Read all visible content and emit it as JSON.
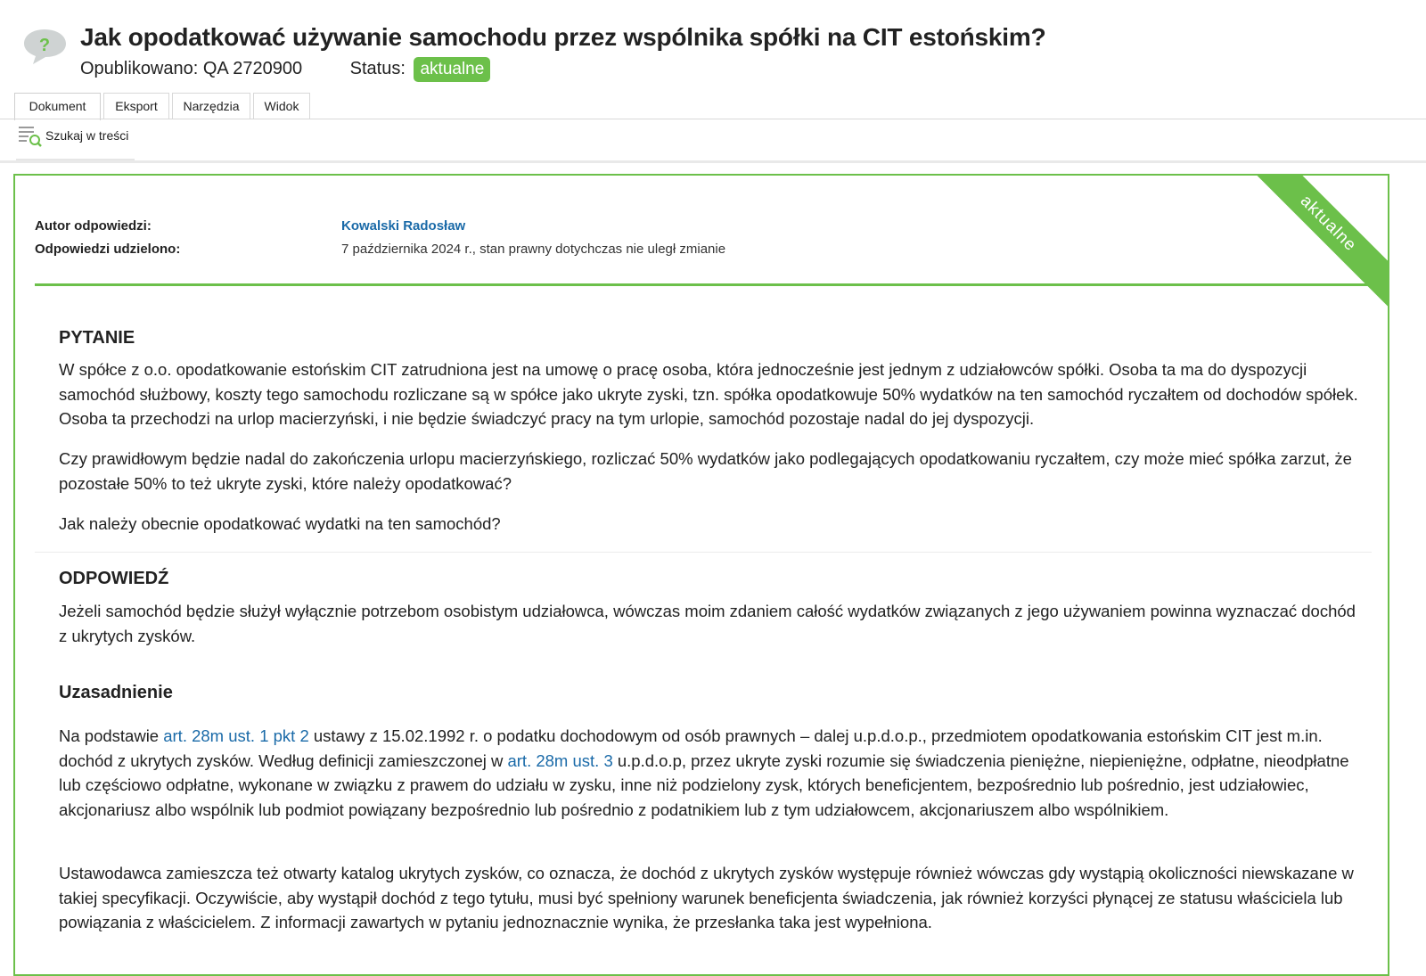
{
  "header": {
    "title": "Jak opodatkować używanie samochodu przez wspólnika spółki na CIT estońskim?",
    "published_label": "Opublikowano:",
    "published_value": "QA 2720900",
    "status_label": "Status:",
    "status_badge": "aktualne",
    "icon": "question-bubble-icon"
  },
  "tabs": [
    {
      "label": "Dokument",
      "active": true
    },
    {
      "label": "Eksport",
      "active": false
    },
    {
      "label": "Narzędzia",
      "active": false
    },
    {
      "label": "Widok",
      "active": false
    }
  ],
  "toolbar": {
    "search_label": "Szukaj w treści",
    "search_icon": "search-lines-icon"
  },
  "card": {
    "ribbon": "aktualne",
    "author_label": "Autor odpowiedzi:",
    "author_value": "Kowalski Radosław",
    "answered_label": "Odpowiedzi udzielono:",
    "answered_value": "7 października 2024 r., stan prawny dotychczas nie uległ zmianie"
  },
  "question": {
    "heading": "PYTANIE",
    "p1": "W spółce z o.o. opodatkowanie estońskim CIT zatrudniona jest na umowę o pracę osoba, która jednocześnie jest jednym z udziałowców spółki. Osoba ta ma do dyspozycji samochód służbowy, koszty tego samochodu rozliczane są w spółce jako ukryte zyski, tzn. spółka opodatkowuje 50% wydatków na ten samochód ryczałtem od dochodów spółek. Osoba ta przechodzi na urlop macierzyński, i nie będzie świadczyć pracy na tym urlopie, samochód pozostaje nadal do jej dyspozycji.",
    "p2": "Czy prawidłowym będzie nadal do zakończenia urlopu macierzyńskiego, rozliczać 50% wydatków jako podlegających opodatkowaniu ryczałtem, czy może mieć spółka zarzut, że pozostałe 50% to też ukryte zyski, które należy opodatkować?",
    "p3": "Jak należy obecnie opodatkować wydatki na ten samochód?"
  },
  "answer": {
    "heading": "ODPOWIEDŹ",
    "p1": "Jeżeli samochód będzie służył wyłącznie potrzebom osobistym udziałowca, wówczas moim zdaniem całość wydatków związanych z jego używaniem powinna wyznaczać dochód z ukrytych zysków."
  },
  "justification": {
    "heading": "Uzasadnienie",
    "p1_a": "Na podstawie ",
    "p1_link1": "art. 28m ust. 1 pkt 2",
    "p1_b": " ustawy z 15.02.1992 r. o podatku dochodowym od osób prawnych – dalej u.p.d.o.p., przedmiotem opodatkowania estońskim CIT jest m.in. dochód z ukrytych zysków. Według definicji zamieszczonej w ",
    "p1_link2": "art. 28m ust. 3",
    "p1_c": " u.p.d.o.p, przez ukryte zyski rozumie się świadczenia pieniężne, niepieniężne, odpłatne, nieodpłatne lub częściowo odpłatne, wykonane w związku z prawem do udziału w zysku, inne niż podzielony zysk, których beneficjentem, bezpośrednio lub pośrednio, jest udziałowiec, akcjonariusz albo wspólnik lub podmiot powiązany bezpośrednio lub pośrednio z podatnikiem lub z tym udziałowcem, akcjonariuszem albo wspólnikiem.",
    "p2": "Ustawodawca zamieszcza też otwarty katalog ukrytych zysków, co oznacza, że dochód z ukrytych zysków występuje również wówczas gdy wystąpią okoliczności niewskazane w takiej specyfikacji. Oczywiście, aby wystąpił dochód z tego tytułu, musi być spełniony warunek beneficjenta świadczenia, jak również korzyści płynącej ze statusu właściciela lub powiązania z właścicielem. Z informacji zawartych w pytaniu jednoznacznie wynika, że przesłanka taka jest wypełniona."
  },
  "colors": {
    "accent_green": "#6cc04a",
    "link_blue": "#1a6aa8"
  }
}
